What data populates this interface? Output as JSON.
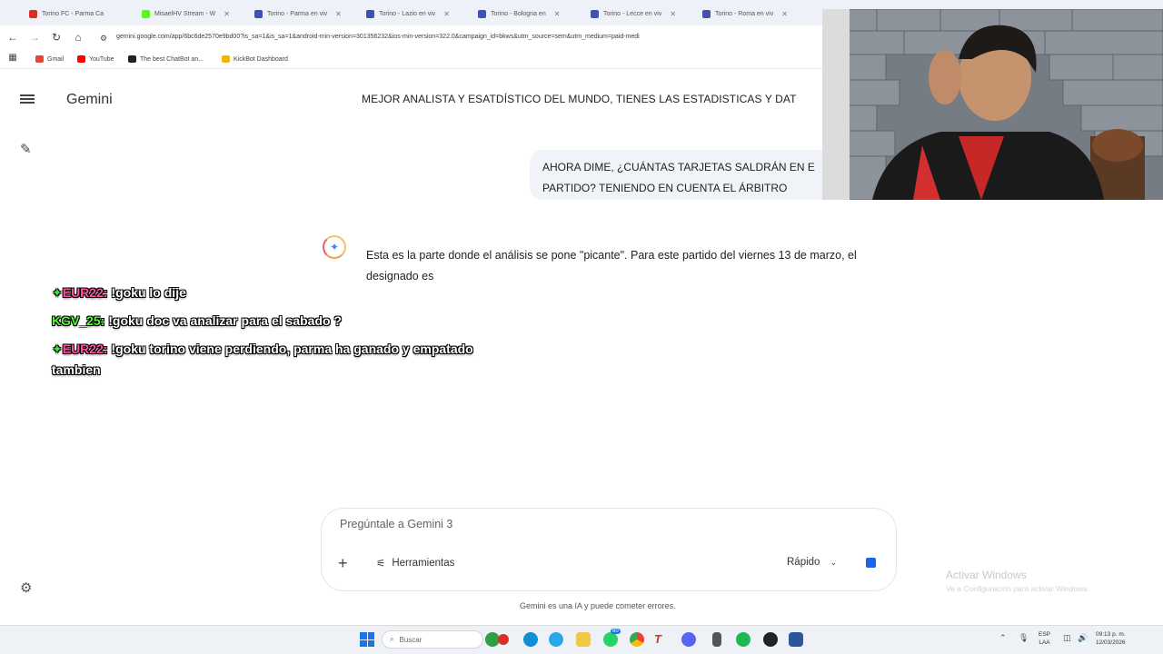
{
  "browser": {
    "tabs": [
      {
        "label": "Torino FC - Parma Ca",
        "color": "#d93025"
      },
      {
        "label": "MisaelHV Stream - W",
        "color": "#53fc18"
      },
      {
        "label": "Torino - Parma en viv",
        "color": "#3f51b5"
      },
      {
        "label": "Torino - Lazio en viv",
        "color": "#3f51b5"
      },
      {
        "label": "Torino - Bologna en",
        "color": "#3f51b5"
      },
      {
        "label": "Torino - Lecce en viv",
        "color": "#3f51b5"
      },
      {
        "label": "Torino - Roma en viv",
        "color": "#3f51b5"
      }
    ],
    "url": "gemini.google.com/app/6bc6de2570e9bd00?is_sa=1&is_sa=1&android-min-version=301356232&ios-min-version=322.0&campaign_id=bkws&utm_source=sem&utm_medium=paid-medi",
    "bookmarks": [
      {
        "label": "Gmail",
        "color": "#ea4335"
      },
      {
        "label": "YouTube",
        "color": "#ff0000"
      },
      {
        "label": "The best ChatBot an...",
        "color": "#222222"
      },
      {
        "label": "KickBot Dashboard",
        "color": "#f4b400"
      }
    ]
  },
  "app": {
    "title": "Gemini",
    "conversation_title": "MEJOR ANALISTA Y ESATDÍSTICO DEL MUNDO, TIENES LAS ESTADISTICAS Y DAT",
    "user_message": "AHORA DIME, ¿CUÁNTAS TARJETAS SALDRÁN EN E PARTIDO? TENIENDO EN CUENTA EL ÁRBITRO",
    "model_answer": "Esta es la parte donde el análisis se pone \"picante\". Para este partido del viernes 13 de marzo, el designado es",
    "input_placeholder": "Pregúntale a Gemini 3",
    "tools_label": "Herramientas",
    "mode_label": "Rápido",
    "disclaimer": "Gemini es una IA y puede cometer errores."
  },
  "chat_overlay": [
    {
      "user": "EUR22:",
      "message": "!goku lo dije",
      "user_color": "#ff4fa3",
      "badge": true
    },
    {
      "user": "KGV_25:",
      "message": "!goku doc va analizar para el sabado ?",
      "user_color": "#4cff2a",
      "badge": false
    },
    {
      "user": "EUR22:",
      "message": "!goku torino viene perdiendo, parma ha ganado y empatado tambien",
      "user_color": "#ff4fa3",
      "badge": true
    }
  ],
  "windows": {
    "activate_title": "Activar Windows",
    "activate_sub": "Ve a Configuración para activar Windows."
  },
  "taskbar": {
    "search_label": "Buscar",
    "whatsapp_badge": "60",
    "lang_line1": "ESP",
    "lang_line2": "LAA",
    "time": "09:13 p. m.",
    "date": "12/03/2026"
  },
  "icons": [
    "menu-icon",
    "edit-icon",
    "settings-icon",
    "gemini-spark-icon",
    "plus-icon",
    "tools-icon",
    "chevron-down-icon",
    "stop-icon",
    "windows-start-icon",
    "search-icon"
  ]
}
